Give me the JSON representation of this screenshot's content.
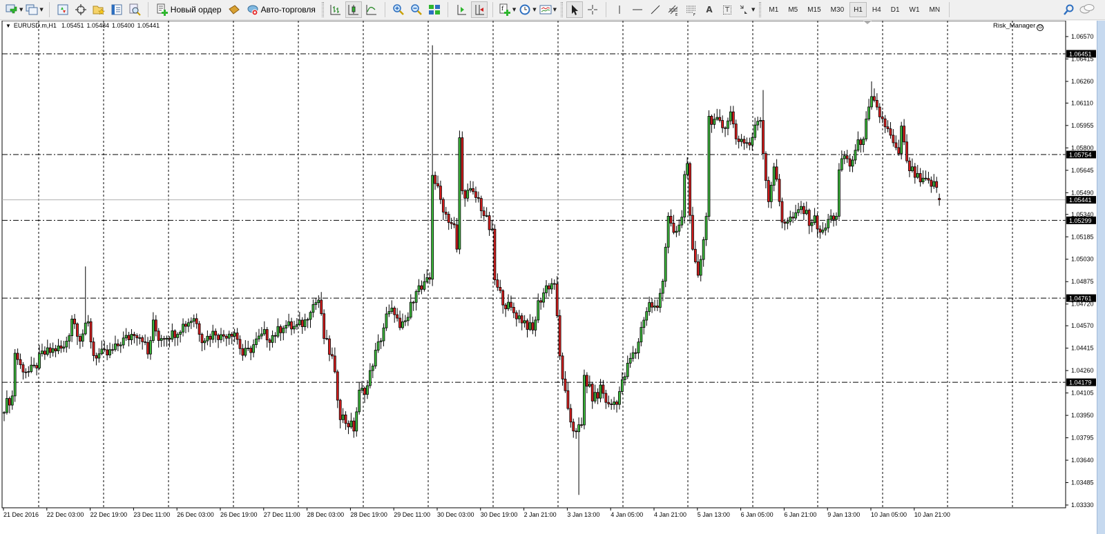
{
  "toolbar": {
    "new_order_label": "Новый ордер",
    "auto_trading_label": "Авто-торговля",
    "timeframes": [
      "M1",
      "M5",
      "M15",
      "M30",
      "H1",
      "H4",
      "D1",
      "W1",
      "MN"
    ],
    "active_timeframe": "H1",
    "text_tool_label": "A",
    "label_tool_label": "T"
  },
  "chart": {
    "symbol_label": "EURUSD.m,H1",
    "ohlc": [
      "1.05451",
      "1.05484",
      "1.05400",
      "1.05441"
    ],
    "indicator_label": "Risk_Manager",
    "indicator_icon": "sad-face-icon",
    "up_color": "#3cb83c",
    "down_color": "#d81e1e"
  },
  "chart_data": {
    "type": "candlestick",
    "title": "EURUSD.m,H1",
    "price_ticks": [
      "1.06570",
      "1.06415",
      "1.06260",
      "1.06110",
      "1.05955",
      "1.05800",
      "1.05645",
      "1.05490",
      "1.05340",
      "1.05185",
      "1.05030",
      "1.04875",
      "1.04720",
      "1.04570",
      "1.04415",
      "1.04260",
      "1.04105",
      "1.03950",
      "1.03795",
      "1.03640",
      "1.03485",
      "1.03330"
    ],
    "ylim": [
      1.0333,
      1.0657
    ],
    "time_labels": [
      "21 Dec 2016",
      "22 Dec 03:00",
      "22 Dec 19:00",
      "23 Dec 11:00",
      "26 Dec 03:00",
      "26 Dec 19:00",
      "27 Dec 11:00",
      "28 Dec 03:00",
      "28 Dec 19:00",
      "29 Dec 11:00",
      "30 Dec 03:00",
      "30 Dec 19:00",
      "2 Jan 21:00",
      "3 Jan 13:00",
      "4 Jan 05:00",
      "4 Jan 21:00",
      "5 Jan 13:00",
      "6 Jan 05:00",
      "6 Jan 21:00",
      "9 Jan 13:00",
      "10 Jan 05:00",
      "10 Jan 21:00"
    ],
    "bars_per_time_label": 16,
    "level_lines": [
      "1.06451",
      "1.05754",
      "1.05299",
      "1.04761",
      "1.04179"
    ],
    "bid_line": "1.05441",
    "close_path": [
      [
        0,
        1.0401
      ],
      [
        3,
        1.0408
      ],
      [
        4,
        1.0439
      ],
      [
        6,
        1.0429
      ],
      [
        9,
        1.0425
      ],
      [
        11,
        1.0427
      ],
      [
        14,
        1.0437
      ],
      [
        17,
        1.0439
      ],
      [
        19,
        1.0441
      ],
      [
        22,
        1.0441
      ],
      [
        24,
        1.0453
      ],
      [
        25,
        1.0463
      ],
      [
        28,
        1.0449
      ],
      [
        31,
        1.0458
      ],
      [
        33,
        1.0437
      ],
      [
        36,
        1.0437
      ],
      [
        38,
        1.0437
      ],
      [
        41,
        1.0441
      ],
      [
        43,
        1.0446
      ],
      [
        46,
        1.0449
      ],
      [
        48,
        1.0453
      ],
      [
        51,
        1.0449
      ],
      [
        53,
        1.0437
      ],
      [
        55,
        1.0458
      ],
      [
        57,
        1.0449
      ],
      [
        60,
        1.0451
      ],
      [
        62,
        1.0451
      ],
      [
        65,
        1.0456
      ],
      [
        68,
        1.046
      ],
      [
        70,
        1.0463
      ],
      [
        73,
        1.0449
      ],
      [
        75,
        1.0449
      ],
      [
        78,
        1.0453
      ],
      [
        80,
        1.0449
      ],
      [
        83,
        1.0453
      ],
      [
        85,
        1.0453
      ],
      [
        88,
        1.0437
      ],
      [
        90,
        1.0439
      ],
      [
        93,
        1.0446
      ],
      [
        96,
        1.0451
      ],
      [
        98,
        1.0449
      ],
      [
        101,
        1.0453
      ],
      [
        103,
        1.0458
      ],
      [
        106,
        1.0456
      ],
      [
        108,
        1.0456
      ],
      [
        111,
        1.046
      ],
      [
        113,
        1.047
      ],
      [
        116,
        1.0475
      ],
      [
        118,
        1.0449
      ],
      [
        121,
        1.0434
      ],
      [
        124,
        1.0396
      ],
      [
        126,
        1.0391
      ],
      [
        129,
        1.0386
      ],
      [
        131,
        1.041
      ],
      [
        134,
        1.0415
      ],
      [
        136,
        1.0432
      ],
      [
        139,
        1.0449
      ],
      [
        141,
        1.0463
      ],
      [
        144,
        1.0468
      ],
      [
        146,
        1.0453
      ],
      [
        149,
        1.0463
      ],
      [
        152,
        1.0484
      ],
      [
        154,
        1.0482
      ],
      [
        157,
        1.0489
      ],
      [
        158,
        1.0563
      ],
      [
        161,
        1.0544
      ],
      [
        163,
        1.0534
      ],
      [
        166,
        1.0525
      ],
      [
        167,
        1.0508
      ],
      [
        168,
        1.0587
      ],
      [
        169,
        1.0549
      ],
      [
        172,
        1.0549
      ],
      [
        175,
        1.0544
      ],
      [
        177,
        1.0534
      ],
      [
        180,
        1.052
      ],
      [
        181,
        1.0489
      ],
      [
        182,
        1.0482
      ],
      [
        185,
        1.0472
      ],
      [
        187,
        1.0468
      ],
      [
        190,
        1.0463
      ],
      [
        192,
        1.046
      ],
      [
        195,
        1.0453
      ],
      [
        197,
        1.0472
      ],
      [
        200,
        1.0484
      ],
      [
        203,
        1.0487
      ],
      [
        205,
        1.0435
      ],
      [
        208,
        1.0396
      ],
      [
        210,
        1.0386
      ],
      [
        213,
        1.0386
      ],
      [
        214,
        1.0422
      ],
      [
        217,
        1.0408
      ],
      [
        219,
        1.0408
      ],
      [
        220,
        1.0415
      ],
      [
        223,
        1.0401
      ],
      [
        226,
        1.0406
      ],
      [
        228,
        1.0417
      ],
      [
        231,
        1.0434
      ],
      [
        233,
        1.0439
      ],
      [
        236,
        1.0463
      ],
      [
        238,
        1.0472
      ],
      [
        241,
        1.0468
      ],
      [
        243,
        1.0491
      ],
      [
        245,
        1.0534
      ],
      [
        247,
        1.0518
      ],
      [
        250,
        1.053
      ],
      [
        251,
        1.0563
      ],
      [
        252,
        1.0568
      ],
      [
        254,
        1.0506
      ],
      [
        256,
        1.0489
      ],
      [
        259,
        1.0534
      ],
      [
        260,
        1.0601
      ],
      [
        262,
        1.0599
      ],
      [
        265,
        1.0594
      ],
      [
        268,
        1.0604
      ],
      [
        270,
        1.0587
      ],
      [
        273,
        1.0585
      ],
      [
        275,
        1.0582
      ],
      [
        278,
        1.0599
      ],
      [
        279,
        1.0601
      ],
      [
        280,
        1.0577
      ],
      [
        282,
        1.0544
      ],
      [
        284,
        1.0568
      ],
      [
        287,
        1.053
      ],
      [
        289,
        1.053
      ],
      [
        292,
        1.0532
      ],
      [
        294,
        1.0539
      ],
      [
        297,
        1.053
      ],
      [
        299,
        1.053
      ],
      [
        302,
        1.052
      ],
      [
        304,
        1.053
      ],
      [
        307,
        1.0534
      ],
      [
        308,
        1.0563
      ],
      [
        310,
        1.0575
      ],
      [
        312,
        1.0568
      ],
      [
        315,
        1.0582
      ],
      [
        317,
        1.0589
      ],
      [
        320,
        1.0613
      ],
      [
        322,
        1.0606
      ],
      [
        325,
        1.0596
      ],
      [
        327,
        1.0587
      ],
      [
        330,
        1.0573
      ],
      [
        331,
        1.0596
      ],
      [
        333,
        1.0568
      ],
      [
        336,
        1.0561
      ],
      [
        338,
        1.0556
      ],
      [
        341,
        1.0556
      ],
      [
        344,
        1.0553
      ],
      [
        345,
        1.05441
      ]
    ],
    "extremes": [
      {
        "bar": 30,
        "high": 1.0498
      },
      {
        "bar": 158,
        "high": 1.0651
      },
      {
        "bar": 168,
        "high": 1.0592
      },
      {
        "bar": 212,
        "low": 1.034
      },
      {
        "bar": 280,
        "high": 1.062
      },
      {
        "bar": 320,
        "high": 1.0626
      }
    ]
  }
}
